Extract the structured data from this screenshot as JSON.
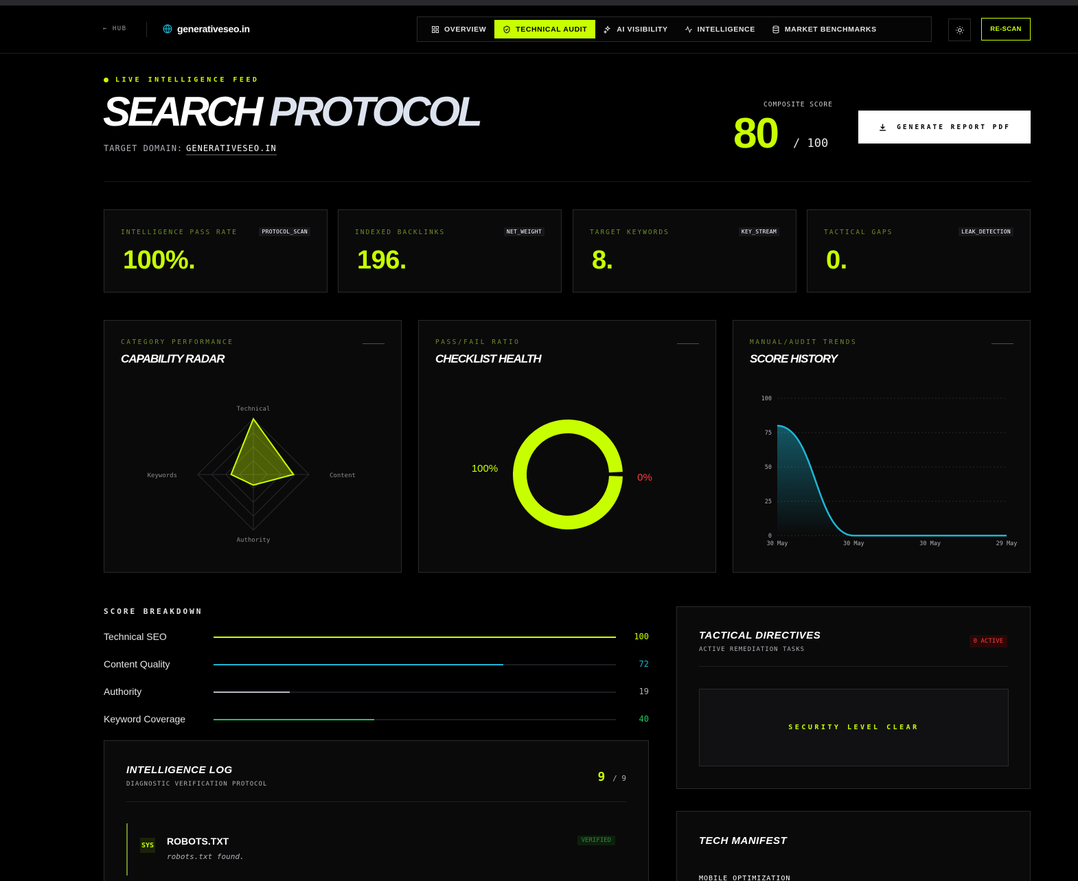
{
  "nav": {
    "hub": "← HUB",
    "brand": "generativeseo.in",
    "tabs": [
      {
        "label": "OVERVIEW",
        "icon": "grid-icon",
        "active": false
      },
      {
        "label": "TECHNICAL AUDIT",
        "icon": "shield-check-icon",
        "active": true
      },
      {
        "label": "AI VISIBILITY",
        "icon": "sparkles-icon",
        "active": false
      },
      {
        "label": "INTELLIGENCE",
        "icon": "activity-icon",
        "active": false
      },
      {
        "label": "MARKET BENCHMARKS",
        "icon": "database-icon",
        "active": false
      }
    ],
    "theme_icon": "sun-icon",
    "rescan": "RE-SCAN"
  },
  "hero": {
    "live": "LIVE INTELLIGENCE FEED",
    "title_1": "SEARCH",
    "title_2": "PROTOCOL",
    "domain_label": "TARGET DOMAIN:",
    "domain_value": "GENERATIVESEO.IN",
    "composite_label": "COMPOSITE SCORE",
    "composite_score": "80",
    "composite_total": "/ 100",
    "report_button": "GENERATE REPORT PDF"
  },
  "stats": [
    {
      "label": "INTELLIGENCE PASS RATE",
      "tag": "PROTOCOL_SCAN",
      "value": "100%."
    },
    {
      "label": "INDEXED BACKLINKS",
      "tag": "NET_WEIGHT",
      "value": "196."
    },
    {
      "label": "TARGET KEYWORDS",
      "tag": "KEY_STREAM",
      "value": "8."
    },
    {
      "label": "TACTICAL GAPS",
      "tag": "LEAK_DETECTION",
      "value": "0."
    }
  ],
  "panels": {
    "radar": {
      "kicker": "CATEGORY PERFORMANCE",
      "title": "CAPABILITY RADAR"
    },
    "health": {
      "kicker": "PASS/FAIL RATIO",
      "title": "CHECKLIST HEALTH"
    },
    "history": {
      "kicker": "MANUAL/AUDIT TRENDS",
      "title": "SCORE HISTORY"
    }
  },
  "chart_data": [
    {
      "type": "radar",
      "categories": [
        "Technical",
        "Content",
        "Authority",
        "Keywords"
      ],
      "values": [
        100,
        72,
        19,
        40
      ],
      "max": 100,
      "color": "#c8ff00"
    },
    {
      "type": "pie",
      "labels": [
        "100%",
        "0%"
      ],
      "values": [
        100,
        0
      ],
      "colors": [
        "#c8ff00",
        "#ff3b3b"
      ]
    },
    {
      "type": "area",
      "x": [
        "30 May",
        "30 May",
        "30 May",
        "29 May"
      ],
      "y": [
        80,
        0,
        0,
        0
      ],
      "ylim": [
        0,
        100
      ],
      "yticks": [
        "100",
        "75",
        "50",
        "25",
        "0"
      ],
      "grid": true,
      "color": "#1fb6d4"
    }
  ],
  "breakdown": {
    "title": "SCORE BREAKDOWN",
    "rows": [
      {
        "name": "Technical SEO",
        "value": 100,
        "label": "100",
        "color": "#c8ff00"
      },
      {
        "name": "Content Quality",
        "value": 72,
        "label": "72",
        "color": "#1fb6d4"
      },
      {
        "name": "Authority",
        "value": 19,
        "label": "19",
        "color": "#b8b8c0"
      },
      {
        "name": "Keyword Coverage",
        "value": 40,
        "label": "40",
        "color": "#22c55e"
      }
    ]
  },
  "log": {
    "title": "INTELLIGENCE LOG",
    "subtitle": "DIAGNOSTIC VERIFICATION PROTOCOL",
    "count": "9",
    "total": "/ 9",
    "items": [
      {
        "badge": "SYS",
        "name": "ROBOTS.TXT",
        "desc": "robots.txt found.",
        "status": "VERIFIED"
      }
    ]
  },
  "directives": {
    "title": "TACTICAL DIRECTIVES",
    "subtitle": "ACTIVE REMEDIATION TASKS",
    "badge": "0 ACTIVE",
    "status": "SECURITY LEVEL CLEAR"
  },
  "manifest": {
    "title": "TECH MANIFEST",
    "first_item": "MOBILE OPTIMIZATION"
  }
}
